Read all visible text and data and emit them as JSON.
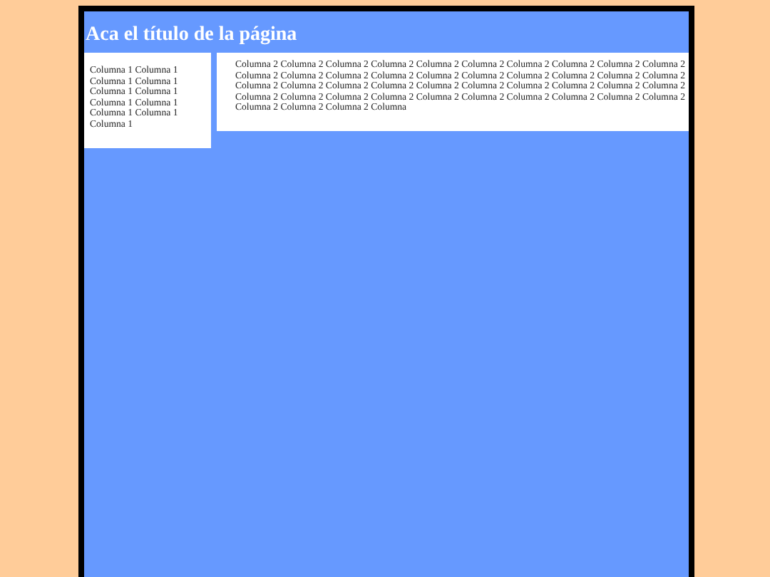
{
  "header": {
    "title": "Aca el título de la página"
  },
  "column_1": {
    "text": "Columna 1 Columna 1 Columna 1 Columna 1 Columna 1 Columna 1 Columna 1 Columna 1 Columna 1 Columna 1 Columna 1"
  },
  "column_2": {
    "text": "Columna 2 Columna 2 Columna 2 Columna 2 Columna 2 Columna 2 Columna 2 Columna 2 Columna 2 Columna 2 Columna 2 Columna 2 Columna 2 Columna 2 Columna 2 Columna 2 Columna 2 Columna 2 Columna 2 Columna 2 Columna 2 Columna 2 Columna 2 Columna 2 Columna 2 Columna 2 Columna 2 Columna 2 Columna 2 Columna 2 Columna 2 Columna 2 Columna 2 Columna 2 Columna 2 Columna 2 Columna 2 Columna 2 Columna 2 Columna 2 Columna 2 Columna 2 Columna 2 Columna"
  }
}
